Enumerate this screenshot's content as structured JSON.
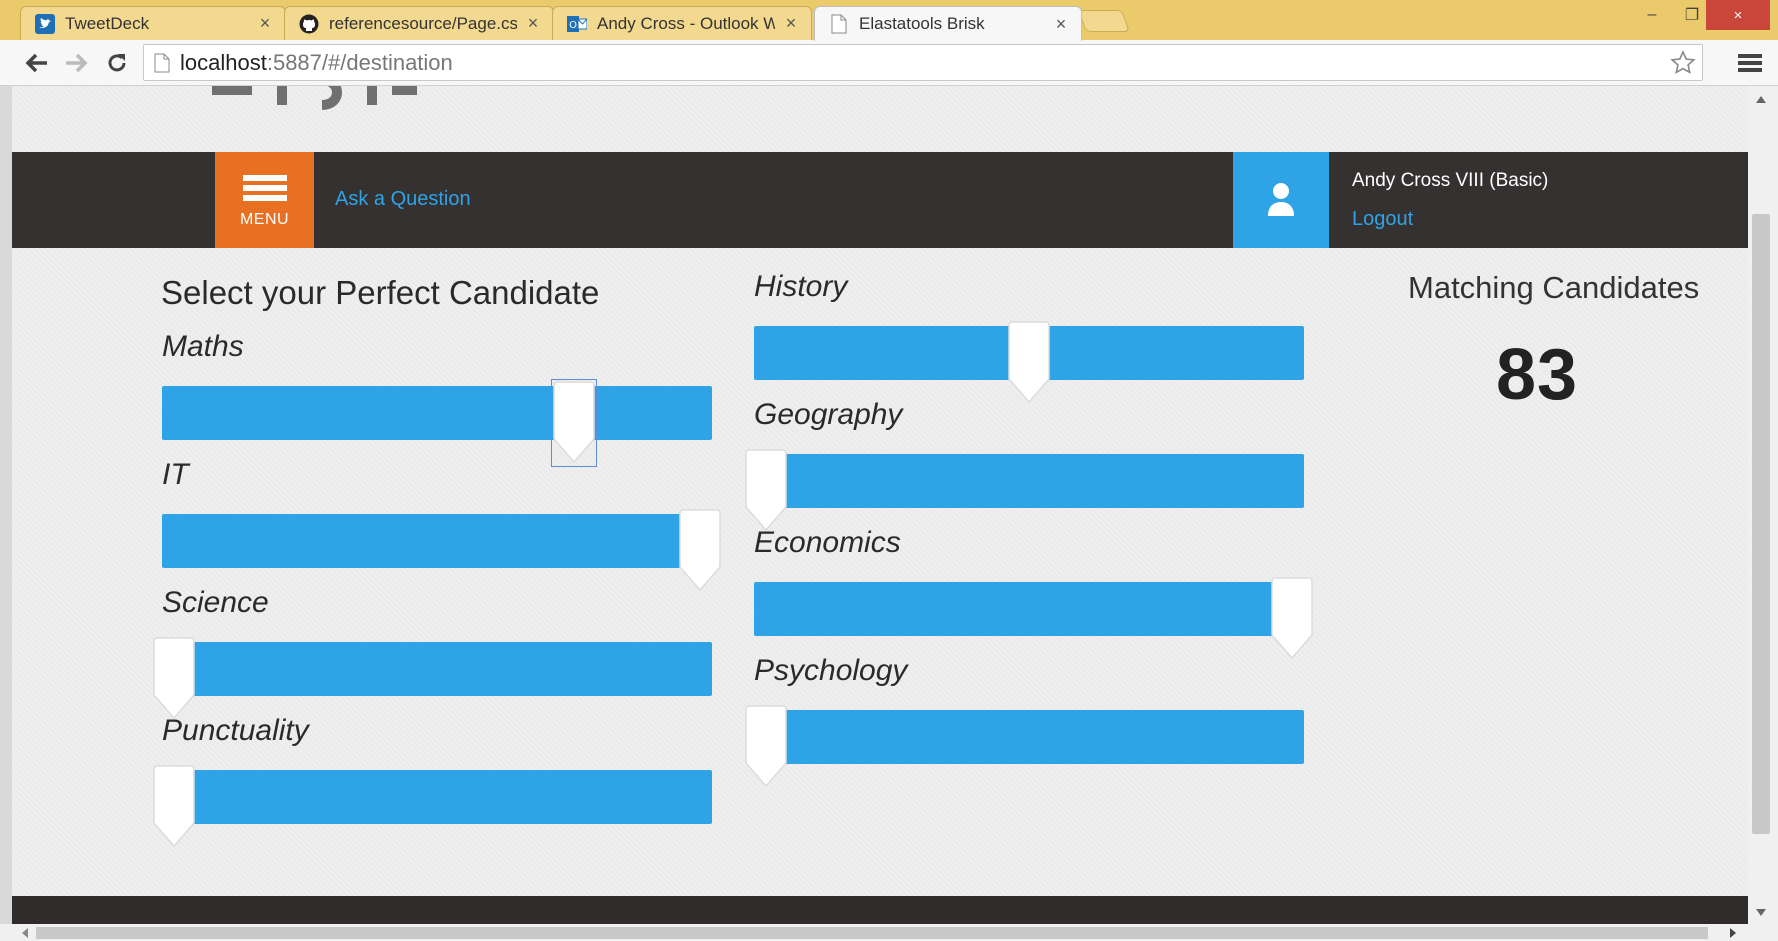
{
  "browser": {
    "tabs": [
      {
        "title": "TweetDeck",
        "icon": "twitter-icon",
        "active": false
      },
      {
        "title": "referencesource/Page.cs at",
        "icon": "github-icon",
        "active": false
      },
      {
        "title": "Andy Cross - Outlook Web",
        "icon": "outlook-icon",
        "active": false
      },
      {
        "title": "Elastatools Brisk",
        "icon": "page-icon",
        "active": true
      }
    ],
    "close_glyph": "×",
    "url_host": "localhost",
    "url_rest": ":5887/#/destination",
    "window_controls": {
      "minimize": "–",
      "maximize": "❐",
      "close": "×"
    }
  },
  "app": {
    "header": {
      "menu_label": "MENU",
      "ask_link": "Ask a Question",
      "user_name": "Andy Cross VIII (Basic)",
      "logout": "Logout"
    },
    "title": "Select your Perfect Candidate",
    "sliders": [
      {
        "label": "Maths",
        "value": 0.76,
        "focused": true
      },
      {
        "label": "IT",
        "value": 1.0,
        "focused": false
      },
      {
        "label": "Science",
        "value": 0.0,
        "focused": false
      },
      {
        "label": "Punctuality",
        "value": 0.0,
        "focused": false
      },
      {
        "label": "History",
        "value": 0.5,
        "focused": false
      },
      {
        "label": "Geography",
        "value": 0.0,
        "focused": false
      },
      {
        "label": "Economics",
        "value": 1.0,
        "focused": false
      },
      {
        "label": "Psychology",
        "value": 0.0,
        "focused": false
      }
    ],
    "matching": {
      "title": "Matching Candidates",
      "count": "83"
    },
    "colors": {
      "accent_blue": "#2ea3e6",
      "menu_orange": "#e87023",
      "header_dark": "#353130"
    }
  }
}
